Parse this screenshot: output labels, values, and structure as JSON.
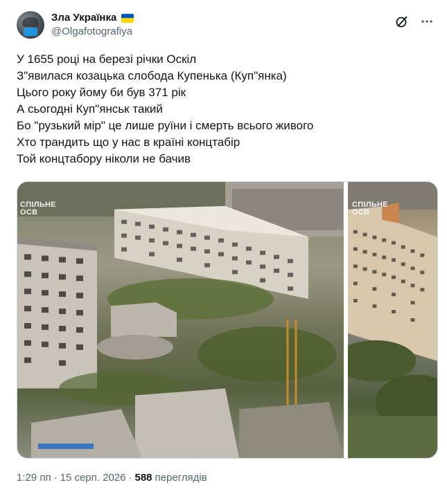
{
  "author": {
    "display_name": "Зла Українка",
    "handle": "@Olgafotografiya",
    "avatar_icon": "profile-avatar"
  },
  "header_actions": [
    {
      "icon": "grok-icon"
    },
    {
      "icon": "more-icon"
    }
  ],
  "tweet": {
    "lines": [
      "У 1655 році на березі річки Оскіл",
      "З\"явилася козацька слобода Купенька (Куп\"янка)",
      "Цього року йому би був 371 рік",
      "А сьогодні Куп\"янськ такий",
      "Бо \"рузький мір\" це лише руїни і смерть всього живого",
      "Хто трандить що у нас в країні концтабір",
      "Той концтабору ніколи не бачив"
    ]
  },
  "media": {
    "watermark_line1": "СПІЛЬНЕ",
    "watermark_line2": "ОСВ",
    "watermark_b_line1": "СПІЛЬНЕ",
    "watermark_b_line2": "ОСВ"
  },
  "footer": {
    "time": "1:29 пп",
    "separator": "·",
    "date": "15 серп. 2026",
    "separator2": "·",
    "views_count": "588",
    "views_label": "переглядів"
  },
  "colors": {
    "text": "#0f1419",
    "secondary": "#536471",
    "flag_blue": "#0057b7",
    "flag_yellow": "#ffd700"
  }
}
